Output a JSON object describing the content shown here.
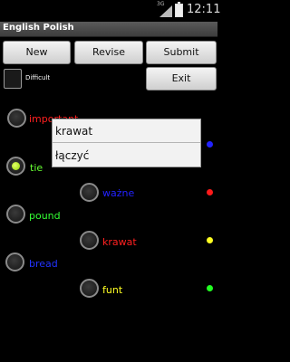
{
  "status_bar": {
    "signal_label": "3G",
    "time": "12:11"
  },
  "title": "English Polish",
  "buttons": {
    "new": "New",
    "revise": "Revise",
    "submit": "Submit",
    "exit": "Exit"
  },
  "difficult_label": "Difficult",
  "left_words": [
    {
      "text": "important",
      "color": "#ff2020",
      "checked": false
    },
    {
      "text": "tie",
      "color": "#66ff33",
      "checked": true
    },
    {
      "text": "pound",
      "color": "#33ff33",
      "checked": false
    },
    {
      "text": "bread",
      "color": "#2233ff",
      "checked": false
    }
  ],
  "right_words": [
    {
      "text": "ważne",
      "color": "#2222ff"
    },
    {
      "text": "krawat",
      "color": "#ff2020"
    },
    {
      "text": "funt",
      "color": "#ffff22"
    }
  ],
  "indicator_dots": [
    "#2222ff",
    "#ff1a1a",
    "#ffff22",
    "#22ff22"
  ],
  "popup_options": [
    "krawat",
    "łączyć"
  ]
}
